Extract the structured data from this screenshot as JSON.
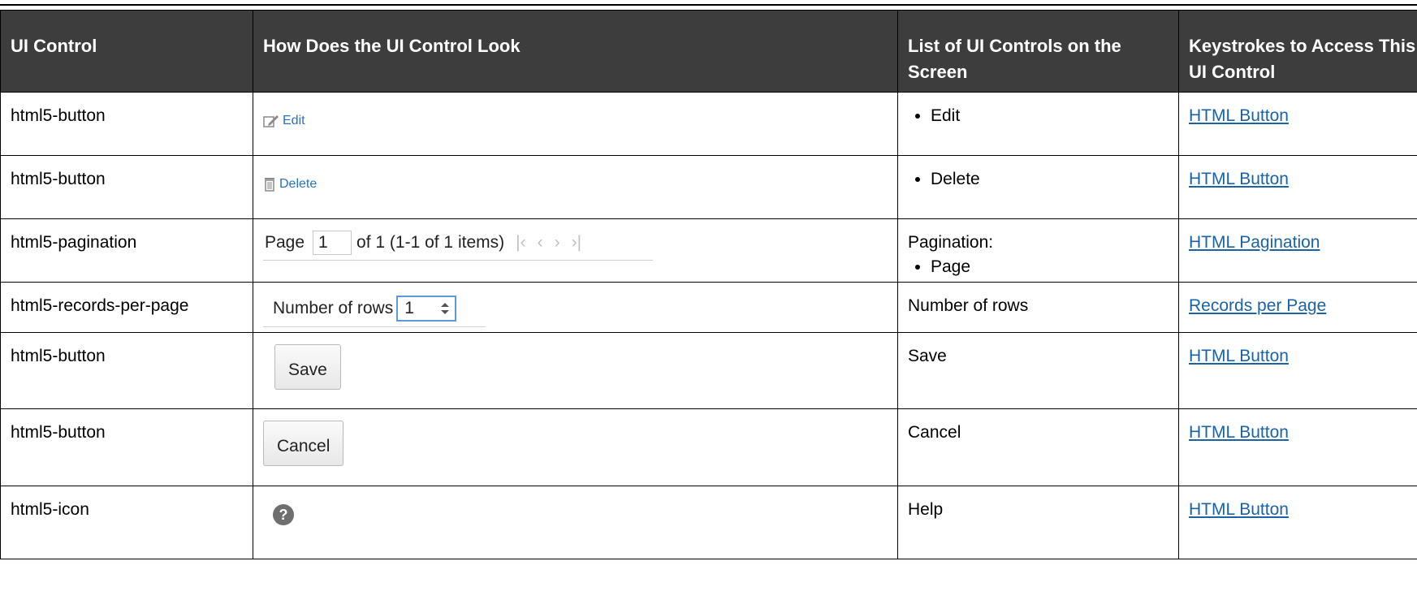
{
  "headers": {
    "col1": "UI Control",
    "col2": "How Does the UI Control Look",
    "col3": "List of UI Controls on the Screen",
    "col4": "Keystrokes to Access This UI Control"
  },
  "rows": [
    {
      "control": "html5-button",
      "sample_label": "Edit",
      "list_item": "Edit",
      "link": "HTML Button"
    },
    {
      "control": "html5-button",
      "sample_label": "Delete",
      "list_item": "Delete",
      "link": "HTML Button"
    },
    {
      "control": "html5-pagination",
      "page_label": "Page",
      "page_value": "1",
      "page_info": "of 1 (1-1 of 1 items)",
      "list_heading": "Pagination:",
      "list_item": "Page",
      "link": "HTML Pagination"
    },
    {
      "control": "html5-records-per-page",
      "rows_label": "Number of rows",
      "rows_value": "1",
      "list_text": "Number of rows",
      "link": "Records per Page"
    },
    {
      "control": "html5-button",
      "button_label": "Save",
      "list_text": "Save",
      "link": "HTML Button"
    },
    {
      "control": "html5-button",
      "button_label": "Cancel",
      "list_text": "Cancel",
      "link": "HTML Button"
    },
    {
      "control": "html5-icon",
      "icon_glyph": "?",
      "list_text": "Help",
      "link": "HTML Button"
    }
  ],
  "colors": {
    "header_bg": "#3d3d3d",
    "link": "#1a63a6",
    "accent_blue": "#2a72c0"
  }
}
